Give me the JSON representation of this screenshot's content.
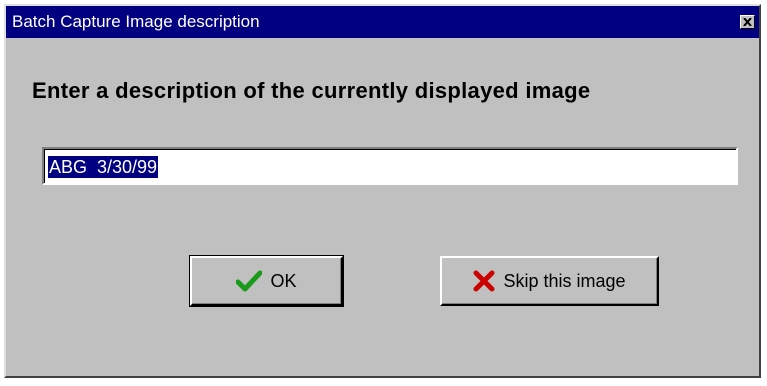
{
  "window": {
    "title": "Batch Capture Image description",
    "close_icon": "close-icon"
  },
  "prompt": {
    "heading": "Enter a description of the currently displayed image"
  },
  "description_input": {
    "value": "ABG  3/30/99",
    "selected": true
  },
  "buttons": {
    "ok": {
      "label": "OK",
      "icon": "checkmark-icon",
      "icon_color": "#1a9a1a"
    },
    "skip": {
      "label": "Skip this image",
      "icon": "x-mark-icon",
      "icon_color": "#cc0000"
    }
  },
  "colors": {
    "titlebar": "#000080",
    "dialog_face": "#c0c0c0",
    "selection": "#000080"
  }
}
